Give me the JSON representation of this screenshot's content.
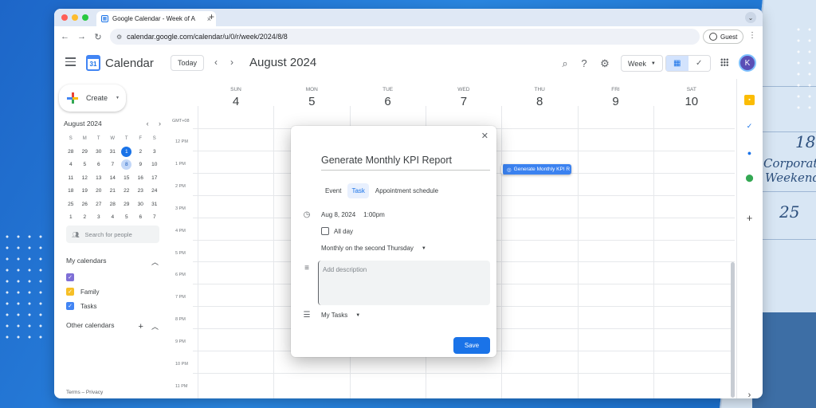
{
  "background": {
    "calendar_numbers": [
      "18",
      "25"
    ],
    "note_text": [
      "Corporate",
      "Weekend"
    ]
  },
  "browser": {
    "tab_title": "Google Calendar - Week of A",
    "tab_close": "×",
    "new_tab": "+",
    "url": "calendar.google.com/calendar/u/0/r/week/2024/8/8",
    "profile_label": "Guest"
  },
  "header": {
    "app_name": "Calendar",
    "logo_day": "31",
    "today_label": "Today",
    "prev": "‹",
    "next": "›",
    "month_label": "August 2024",
    "view_label": "Week"
  },
  "user": {
    "avatar_letter": "K"
  },
  "sidebar": {
    "create_label": "Create",
    "mini_calendar": {
      "month": "August 2024",
      "weekday_initials": [
        "S",
        "M",
        "T",
        "W",
        "T",
        "F",
        "S"
      ],
      "days": [
        "28",
        "29",
        "30",
        "31",
        "1",
        "2",
        "3",
        "4",
        "5",
        "6",
        "7",
        "8",
        "9",
        "10",
        "11",
        "12",
        "13",
        "14",
        "15",
        "16",
        "17",
        "18",
        "19",
        "20",
        "21",
        "22",
        "23",
        "24",
        "25",
        "26",
        "27",
        "28",
        "29",
        "30",
        "31",
        "1",
        "2",
        "3",
        "4",
        "5",
        "6",
        "7"
      ],
      "today_index": 4,
      "selected_index": 11
    },
    "search_people_placeholder": "Search for people",
    "my_calendars_label": "My calendars",
    "calendars": [
      {
        "name": "",
        "color": "#7e6fd6"
      },
      {
        "name": "Family",
        "color": "#f6bf26"
      },
      {
        "name": "Tasks",
        "color": "#4285f4"
      }
    ],
    "other_calendars_label": "Other calendars",
    "footer": "Terms – Privacy"
  },
  "week": {
    "timezone": "GMT+08",
    "days": [
      {
        "name": "SUN",
        "date": "4"
      },
      {
        "name": "MON",
        "date": "5"
      },
      {
        "name": "TUE",
        "date": "6"
      },
      {
        "name": "WED",
        "date": "7"
      },
      {
        "name": "THU",
        "date": "8"
      },
      {
        "name": "FRI",
        "date": "9"
      },
      {
        "name": "SAT",
        "date": "10"
      }
    ],
    "hours": [
      "12 PM",
      "1 PM",
      "2 PM",
      "3 PM",
      "4 PM",
      "5 PM",
      "6 PM",
      "7 PM",
      "8 PM",
      "9 PM",
      "10 PM",
      "11 PM"
    ],
    "event": {
      "title": "Generate Monthly KPI R",
      "day": "THU",
      "time": "1 PM"
    }
  },
  "dialog": {
    "title": "Generate Monthly KPI Report",
    "tabs": [
      "Event",
      "Task",
      "Appointment schedule"
    ],
    "active_tab": "Task",
    "date": "Aug 8, 2024",
    "time": "1:00pm",
    "all_day_label": "All day",
    "all_day_checked": false,
    "repeat": "Monthly on the second Thursday",
    "description_placeholder": "Add description",
    "task_list": "My Tasks",
    "save_label": "Save"
  },
  "colors": {
    "accent": "#1a73e8",
    "event": "#3b82f0",
    "selected_chip": "#d3e3fd"
  }
}
